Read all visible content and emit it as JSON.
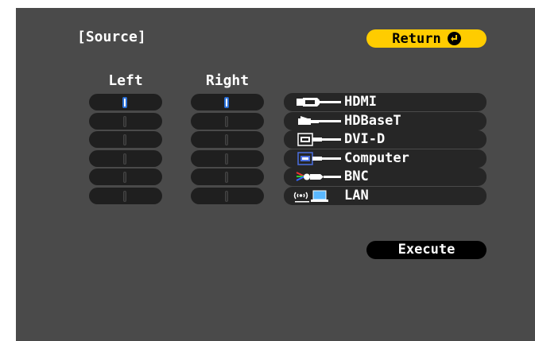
{
  "header": {
    "title": "[Source]",
    "return_label": "Return"
  },
  "columns": {
    "left_label": "Left",
    "right_label": "Right"
  },
  "sources": [
    {
      "label": "HDMI",
      "icon": "hdmi-icon"
    },
    {
      "label": "HDBaseT",
      "icon": "hdbaset-icon"
    },
    {
      "label": "DVI-D",
      "icon": "dvi-icon"
    },
    {
      "label": "Computer",
      "icon": "computer-vga-icon"
    },
    {
      "label": "BNC",
      "icon": "bnc-icon"
    },
    {
      "label": "LAN",
      "icon": "lan-icon"
    }
  ],
  "left_selected_index": 0,
  "right_selected_index": 0,
  "execute_label": "Execute",
  "colors": {
    "background": "#4a4a4a",
    "return_button": "#ffcc00",
    "selected_indicator": "#2a6fd6"
  }
}
